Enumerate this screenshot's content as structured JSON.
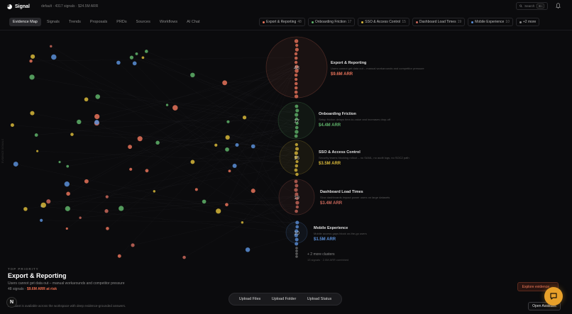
{
  "app": {
    "name": "Signal",
    "workspace": "default · 4317 signals · $24.5M ARR"
  },
  "search": {
    "placeholder": "Search",
    "shortcut": "⌘K"
  },
  "tabs": [
    {
      "label": "Evidence Map",
      "active": true
    },
    {
      "label": "Signals"
    },
    {
      "label": "Trends"
    },
    {
      "label": "Proposals"
    },
    {
      "label": "PRDs"
    },
    {
      "label": "Sources"
    },
    {
      "label": "Workflows"
    },
    {
      "label": "AI Chat"
    }
  ],
  "filters": [
    {
      "label": "Export & Reporting",
      "count": "48",
      "color": "#e8735a"
    },
    {
      "label": "Onboarding Friction",
      "count": "17",
      "color": "#5fb36a"
    },
    {
      "label": "SSO & Access Control",
      "count": "15",
      "color": "#d8b83a"
    },
    {
      "label": "Dashboard Load Times",
      "count": "19",
      "color": "#c9675a"
    },
    {
      "label": "Mobile Experience",
      "count": "10",
      "color": "#5a8fd8"
    },
    {
      "label": "+2 more",
      "count": "",
      "color": "#888888"
    }
  ],
  "clusters": [
    {
      "name": "Export & Reporting",
      "desc": "Users cannot get data out – manual workarounds and competitor pressure",
      "arr": "$9.6M ARR",
      "count": "48",
      "color": "#e8735a"
    },
    {
      "name": "Onboarding Friction",
      "desc": "Setup friction delays time-to-value and increases drop-off",
      "arr": "$4.4M ARR",
      "count": "17",
      "color": "#5fb36a"
    },
    {
      "name": "SSO & Access Control",
      "desc": "Security teams blocking rollout – no SAML, no audit logs, no SOC2 path",
      "arr": "$3.5M ARR",
      "count": "15",
      "color": "#d8b83a"
    },
    {
      "name": "Dashboard Load Times",
      "desc": "Slow dashboards impact power users on large datasets",
      "arr": "$3.4M ARR",
      "count": "19",
      "color": "#c9675a"
    },
    {
      "name": "Mobile Experience",
      "desc": "Mobile access gaps block on-the-go users",
      "arr": "$1.5M ARR",
      "count": "10",
      "color": "#5a8fd8"
    }
  ],
  "more_clusters": {
    "title": "+ 2 more clusters",
    "sub": "13 signals · 2.0M ARR combined"
  },
  "focus": {
    "kicker": "TOP PRIORITY",
    "title": "Export & Reporting",
    "desc": "Users cannot get data out – manual workarounds and competitor pressure",
    "signals": "48 signals · ",
    "risk": "$9.6M ARR at risk"
  },
  "assistant_note": "Assistant is available across the workspace with deep evidence-grounded answers.",
  "badge": "N",
  "upload": {
    "files": "Upload Files",
    "folder": "Upload Folder",
    "status": "Upload Status"
  },
  "explore": "Explore evidence →",
  "open_assistant": "Open Assistant",
  "side_label": "EVIDENCE SIGNALS"
}
